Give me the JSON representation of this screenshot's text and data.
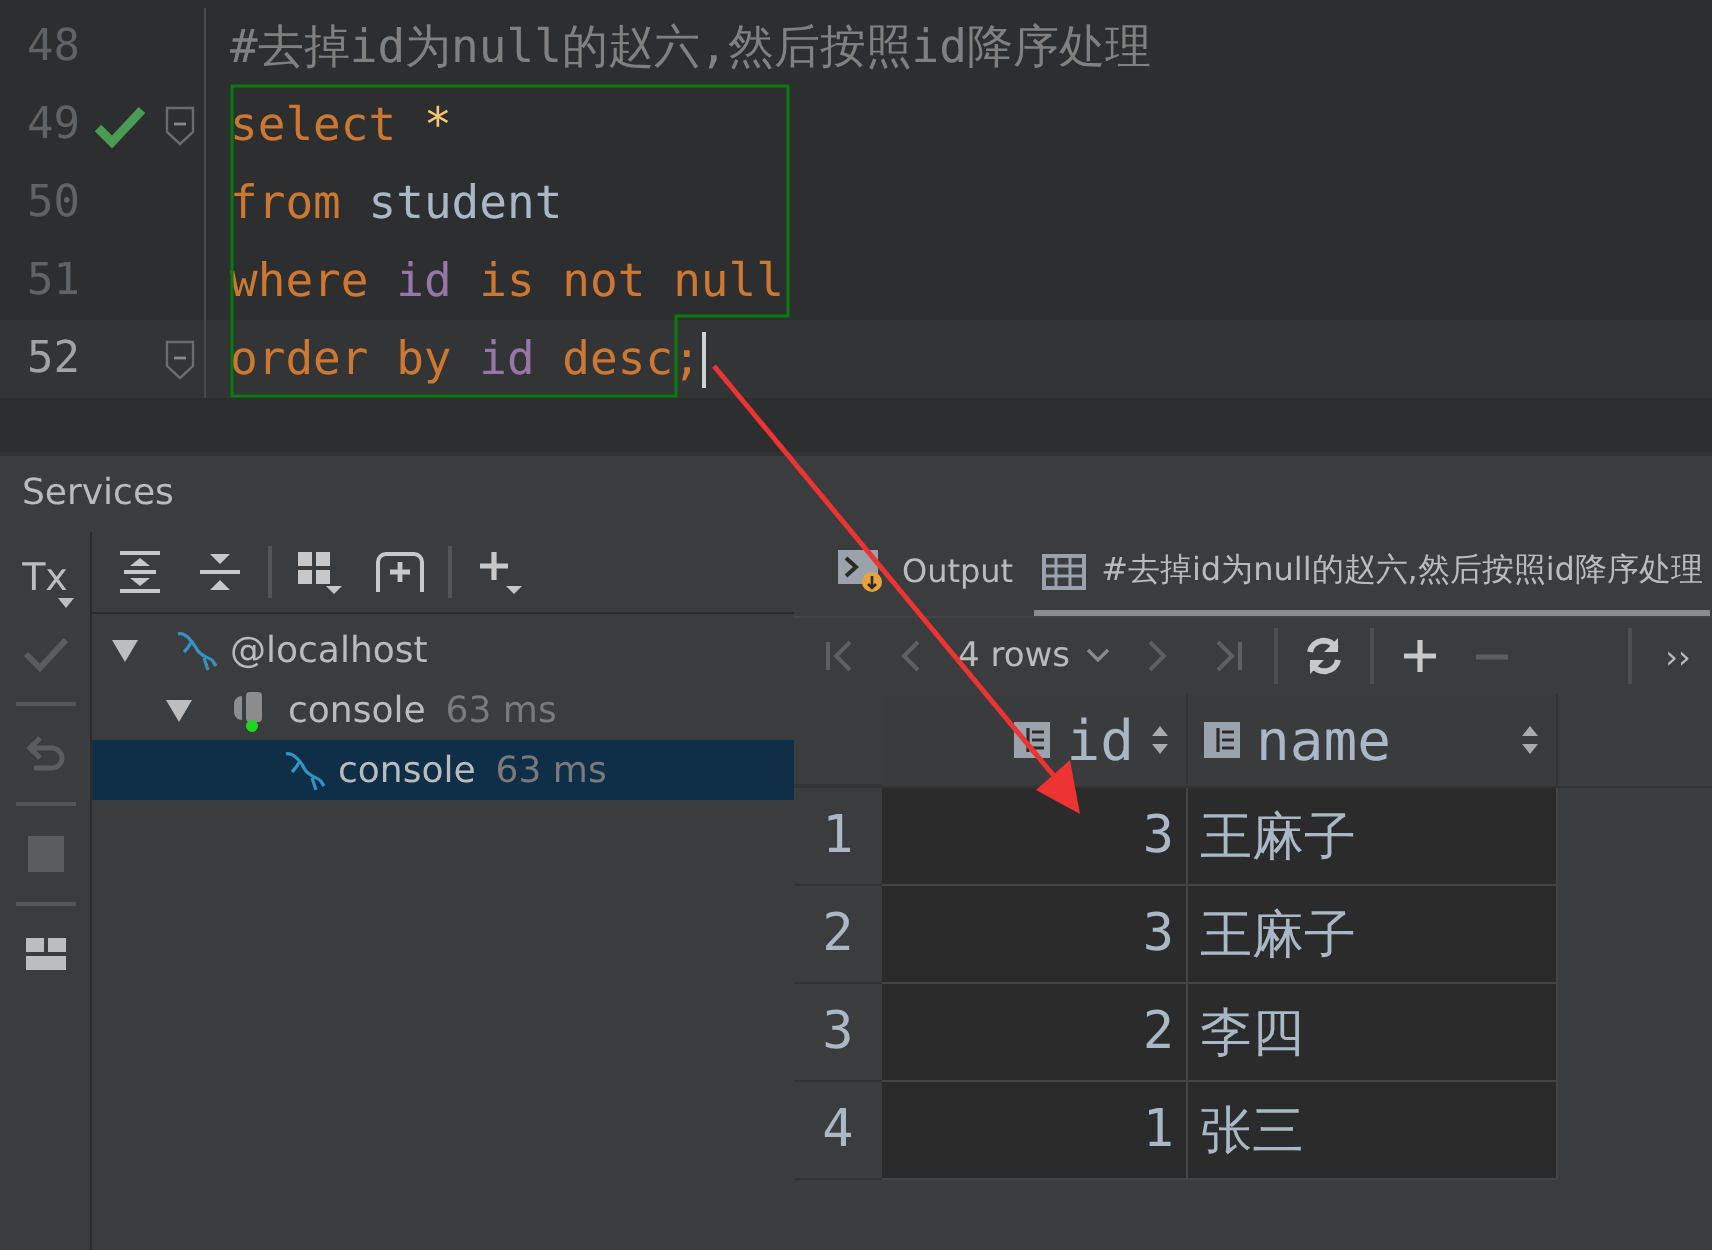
{
  "editor": {
    "lines": [
      {
        "number": "48",
        "check": false,
        "fold": false,
        "current": false,
        "caret": false,
        "tokens": [
          {
            "text": "#去掉id为null的赵六,然后按照id降序处理",
            "kind": "comment"
          }
        ]
      },
      {
        "number": "49",
        "check": true,
        "fold": true,
        "current": false,
        "caret": false,
        "tokens": [
          {
            "text": "select ",
            "kind": "keyword"
          },
          {
            "text": "*",
            "kind": "star"
          }
        ]
      },
      {
        "number": "50",
        "check": false,
        "fold": false,
        "current": false,
        "caret": false,
        "tokens": [
          {
            "text": "from ",
            "kind": "keyword"
          },
          {
            "text": "student",
            "kind": "identifier"
          }
        ]
      },
      {
        "number": "51",
        "check": false,
        "fold": false,
        "current": false,
        "caret": false,
        "tokens": [
          {
            "text": "where ",
            "kind": "keyword"
          },
          {
            "text": "id ",
            "kind": "column"
          },
          {
            "text": "is not null",
            "kind": "keyword"
          }
        ]
      },
      {
        "number": "52",
        "check": false,
        "fold": true,
        "current": true,
        "caret": true,
        "tokens": [
          {
            "text": "order by ",
            "kind": "keyword"
          },
          {
            "text": "id ",
            "kind": "column"
          },
          {
            "text": "desc;",
            "kind": "keyword"
          }
        ]
      }
    ]
  },
  "services": {
    "title": "Services",
    "side_tools": [
      {
        "kind": "tx",
        "label": "Tx",
        "disabled": false
      },
      {
        "kind": "check",
        "disabled": true
      },
      {
        "kind": "undo",
        "disabled": true
      },
      {
        "kind": "stop",
        "disabled": true
      },
      {
        "kind": "layout",
        "disabled": false
      }
    ],
    "tree_tools": [
      {
        "kind": "expand"
      },
      {
        "kind": "collapse"
      },
      {
        "kind": "group"
      },
      {
        "kind": "frame"
      },
      {
        "kind": "add"
      }
    ],
    "tree": [
      {
        "label": "@localhost",
        "kind": "server",
        "expanded": true,
        "selected": false,
        "children": [
          {
            "label": "console",
            "meta": "63 ms",
            "kind": "session",
            "expanded": true,
            "selected": false,
            "children": [
              {
                "label": "console",
                "meta": "63 ms",
                "kind": "server",
                "selected": true
              }
            ]
          }
        ]
      }
    ],
    "tabs": [
      {
        "label": "Output",
        "kind": "output",
        "selected": false
      },
      {
        "label": "#去掉id为null的赵六,然后按照id降序处理",
        "kind": "result",
        "selected": true
      }
    ],
    "rows_label": "4 rows",
    "nav": [
      {
        "kind": "first",
        "disabled": true
      },
      {
        "kind": "prev",
        "disabled": true
      },
      {
        "kind": "rows"
      },
      {
        "kind": "next",
        "disabled": true
      },
      {
        "kind": "last",
        "disabled": true
      },
      {
        "kind": "refresh",
        "disabled": false
      },
      {
        "kind": "plus",
        "disabled": false
      },
      {
        "kind": "minus",
        "disabled": true
      },
      {
        "kind": "more",
        "label": "››"
      }
    ],
    "table": {
      "columns": [
        "id",
        "name"
      ],
      "rows": [
        {
          "n": "1",
          "id": "3",
          "name": "王麻子"
        },
        {
          "n": "2",
          "id": "3",
          "name": "王麻子"
        },
        {
          "n": "3",
          "id": "2",
          "name": "李四"
        },
        {
          "n": "4",
          "id": "1",
          "name": "张三"
        }
      ]
    }
  }
}
